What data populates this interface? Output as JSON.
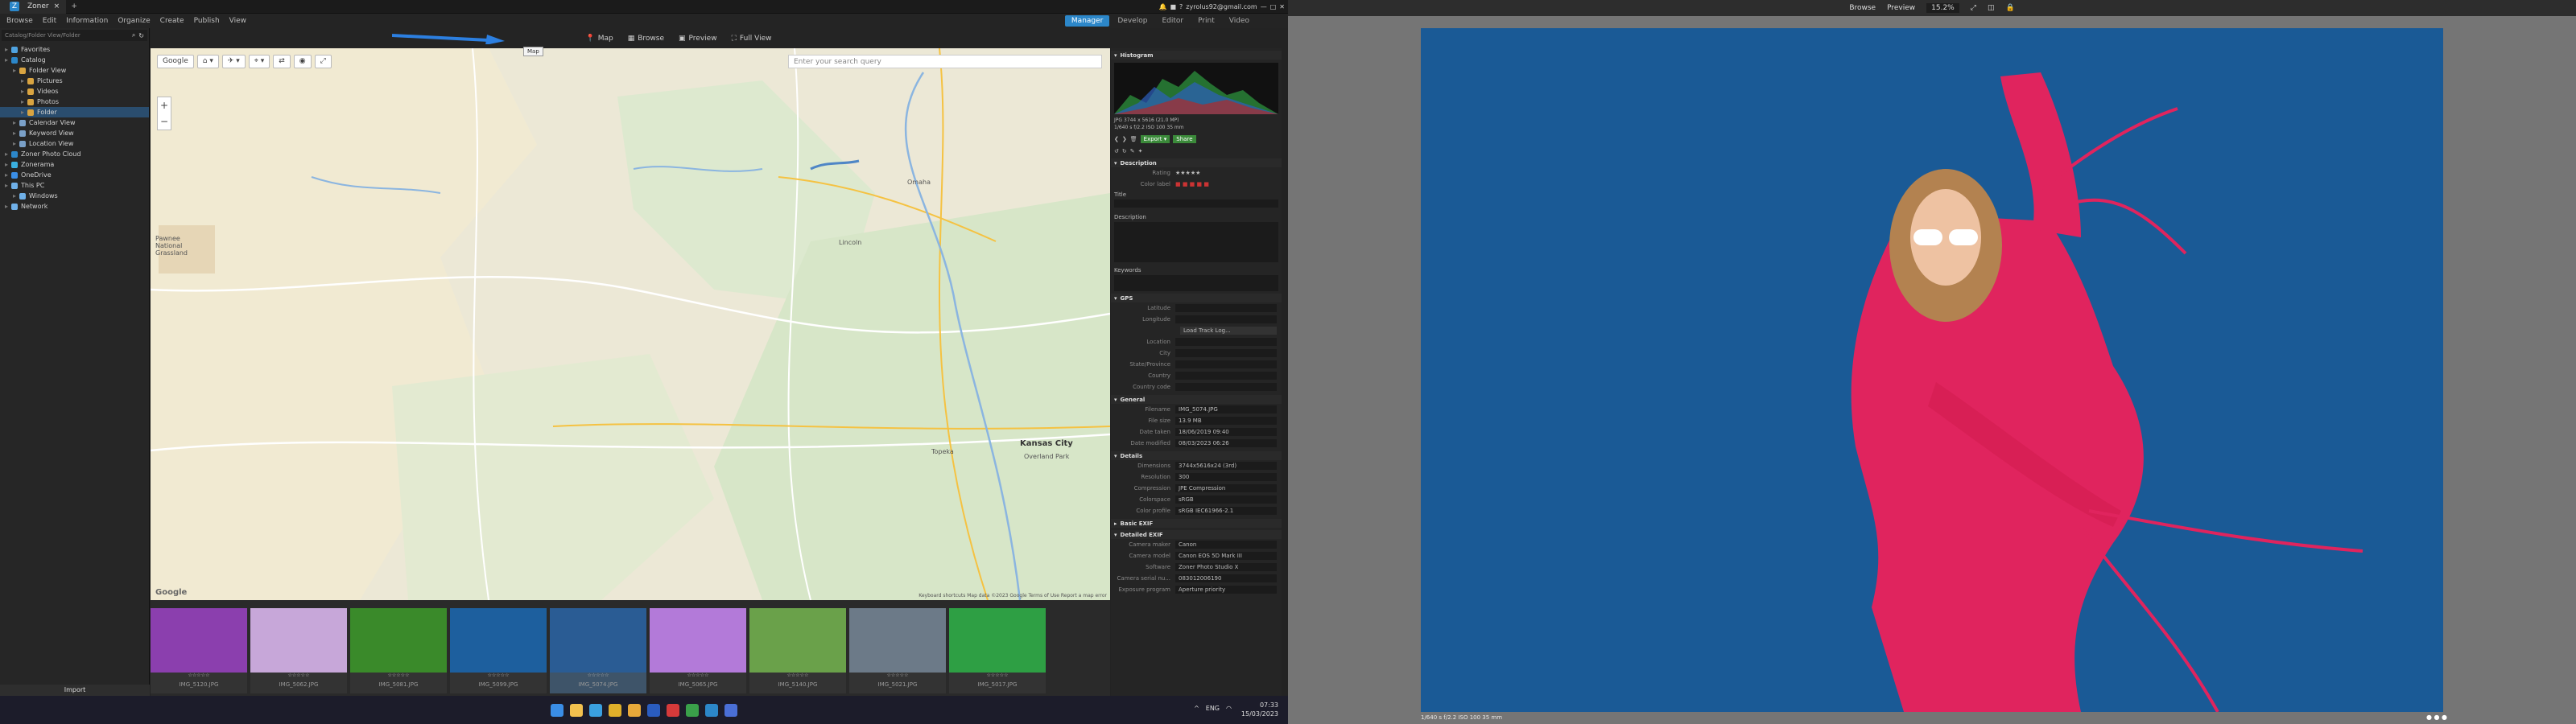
{
  "app": {
    "tab_title": "Zoner",
    "folder_label": "Folder",
    "account": "zyrolus92@gmail.com"
  },
  "menu": [
    "Browse",
    "Edit",
    "Information",
    "Organize",
    "Create",
    "Publish",
    "View"
  ],
  "modes": [
    "Manager",
    "Develop",
    "Editor",
    "Print",
    "Video"
  ],
  "view_tabs": [
    "Map",
    "Browse",
    "Preview",
    "Full View"
  ],
  "tooltip": "Map",
  "search_placeholder": "Catalog/Folder View/Folder",
  "tree": [
    {
      "label": "Favorites",
      "level": 0,
      "type": "star"
    },
    {
      "label": "Catalog",
      "level": 0,
      "type": "catalog"
    },
    {
      "label": "Folder View",
      "level": 1,
      "type": "folder"
    },
    {
      "label": "Pictures",
      "level": 2,
      "type": "folder"
    },
    {
      "label": "Videos",
      "level": 2,
      "type": "folder"
    },
    {
      "label": "Photos",
      "level": 2,
      "type": "folder"
    },
    {
      "label": "Folder",
      "level": 2,
      "type": "folder",
      "selected": true
    },
    {
      "label": "Calendar View",
      "level": 1,
      "type": "cal"
    },
    {
      "label": "Keyword View",
      "level": 1,
      "type": "key"
    },
    {
      "label": "Location View",
      "level": 1,
      "type": "loc"
    },
    {
      "label": "Zoner Photo Cloud",
      "level": 0,
      "type": "cloud"
    },
    {
      "label": "Zonerama",
      "level": 0,
      "type": "zonerama"
    },
    {
      "label": "OneDrive",
      "level": 0,
      "type": "onedrive"
    },
    {
      "label": "This PC",
      "level": 0,
      "type": "pc"
    },
    {
      "label": "Windows",
      "level": 1,
      "type": "drive"
    },
    {
      "label": "Network",
      "level": 0,
      "type": "network"
    }
  ],
  "import_label": "Import",
  "map": {
    "provider": "Google",
    "search_placeholder": "Enter your search query",
    "footer": "Keyboard shortcuts   Map data ©2023 Google   Terms of Use   Report a map error",
    "cities": [
      {
        "name": "Omaha",
        "size": "sm"
      },
      {
        "name": "Lincoln",
        "size": "sm"
      },
      {
        "name": "Topeka",
        "size": "sm"
      },
      {
        "name": "Kansas City",
        "size": "lg"
      },
      {
        "name": "Overland Park",
        "size": "sm"
      },
      {
        "name": "Pawnee National Grassland",
        "size": "sm"
      }
    ]
  },
  "filmstrip": [
    {
      "name": "IMG_5120.JPG",
      "color": "#8b3fae"
    },
    {
      "name": "IMG_5062.JPG",
      "color": "#c7a7d9"
    },
    {
      "name": "IMG_5081.JPG",
      "color": "#3a8a2a"
    },
    {
      "name": "IMG_5099.JPG",
      "color": "#1d5f9e"
    },
    {
      "name": "IMG_5074.JPG",
      "color": "#2a5c94",
      "selected": true
    },
    {
      "name": "IMG_5065.JPG",
      "color": "#b37ad9"
    },
    {
      "name": "IMG_5140.JPG",
      "color": "#6aa14a"
    },
    {
      "name": "IMG_5021.JPG",
      "color": "#6c7a88"
    },
    {
      "name": "IMG_5017.JPG",
      "color": "#2e9f44"
    }
  ],
  "right": {
    "histogram_title": "Histogram",
    "info_line1": "JPG  3744 x 5616 (21.0 MP)",
    "info_line2": "1/640 s   f/2.2   ISO 100   35 mm",
    "description_title": "Description",
    "rating_label": "Rating",
    "color_label": "Color label",
    "title_label": "Title",
    "desc_label": "Description",
    "keywords_label": "Keywords",
    "gps_title": "GPS",
    "gps_rows": [
      "Latitude",
      "Longitude"
    ],
    "gps_button": "Load Track Log...",
    "loc_rows": [
      "Location",
      "City",
      "State/Province",
      "Country",
      "Country code"
    ],
    "general_title": "General",
    "general_rows": [
      {
        "k": "Filename",
        "v": "IMG_5074.JPG"
      },
      {
        "k": "File size",
        "v": "13.9 MB"
      },
      {
        "k": "Date taken",
        "v": "18/06/2019 09:40"
      },
      {
        "k": "Date modified",
        "v": "08/03/2023 06:26"
      }
    ],
    "details_title": "Details",
    "details_rows": [
      {
        "k": "Dimensions",
        "v": "3744x5616x24 (3rd)"
      },
      {
        "k": "Resolution",
        "v": "300"
      },
      {
        "k": "Compression",
        "v": "JPE Compression"
      },
      {
        "k": "Colorspace",
        "v": "sRGB"
      },
      {
        "k": "Color profile",
        "v": "sRGB IEC61966-2.1"
      }
    ],
    "basic_exif": "Basic EXIF",
    "detailed_exif": "Detailed EXIF",
    "exif_rows": [
      {
        "k": "Camera maker",
        "v": "Canon"
      },
      {
        "k": "Camera model",
        "v": "Canon EOS 5D Mark III"
      },
      {
        "k": "Software",
        "v": "Zoner Photo Studio X"
      },
      {
        "k": "Camera serial nu...",
        "v": "083012006190"
      },
      {
        "k": "Exposure program",
        "v": "Aperture priority"
      }
    ]
  },
  "taskbar": {
    "lang": "ENG",
    "time": "07:33",
    "date": "15/03/2023"
  },
  "viewer": {
    "toolbar": [
      "Browse",
      "Preview"
    ],
    "zoom": "15.2%",
    "footer": "1/640 s   f/2.2   ISO 100   35 mm",
    "dots": "● ● ●"
  },
  "colors": {
    "accent": "#2c87c9",
    "photo_bg": "#1d5f9e",
    "dress": "#e0245e"
  }
}
